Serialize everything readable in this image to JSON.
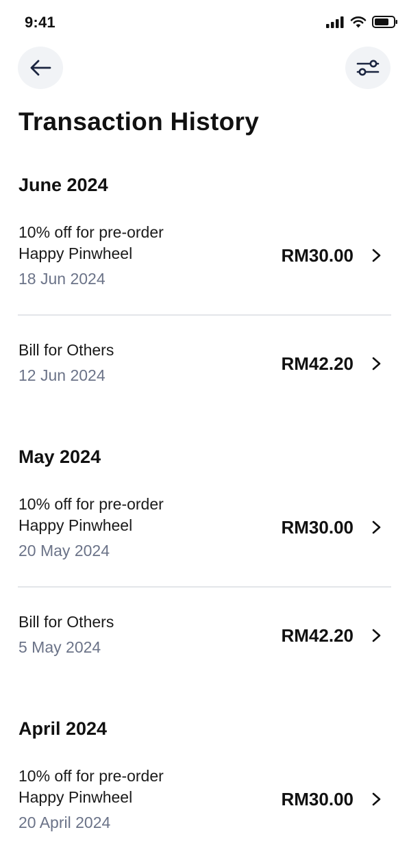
{
  "status_bar": {
    "time": "9:41",
    "icons": [
      "cellular-signal-icon",
      "wifi-icon",
      "battery-icon"
    ]
  },
  "header": {
    "back_icon": "arrow-left-icon",
    "filter_icon": "sliders-filter-icon"
  },
  "page_title": "Transaction History",
  "colors": {
    "text_primary": "#111111",
    "text_secondary": "#6b7388",
    "icon_button_bg": "#f1f3f6",
    "divider": "#e3e5e9"
  },
  "sections": [
    {
      "title": "June 2024",
      "transactions": [
        {
          "line1": "10% off for pre-order",
          "line2": "Happy Pinwheel",
          "date": "18 Jun 2024",
          "amount": "RM30.00"
        },
        {
          "line1": "Bill for Others",
          "line2": "",
          "date": "12 Jun 2024",
          "amount": "RM42.20"
        }
      ]
    },
    {
      "title": "May 2024",
      "transactions": [
        {
          "line1": "10% off for pre-order",
          "line2": "Happy Pinwheel",
          "date": "20 May 2024",
          "amount": "RM30.00"
        },
        {
          "line1": "Bill for Others",
          "line2": "",
          "date": "5 May 2024",
          "amount": "RM42.20"
        }
      ]
    },
    {
      "title": "April 2024",
      "transactions": [
        {
          "line1": "10% off for pre-order",
          "line2": "Happy Pinwheel",
          "date": "20 April 2024",
          "amount": "RM30.00"
        }
      ]
    }
  ]
}
